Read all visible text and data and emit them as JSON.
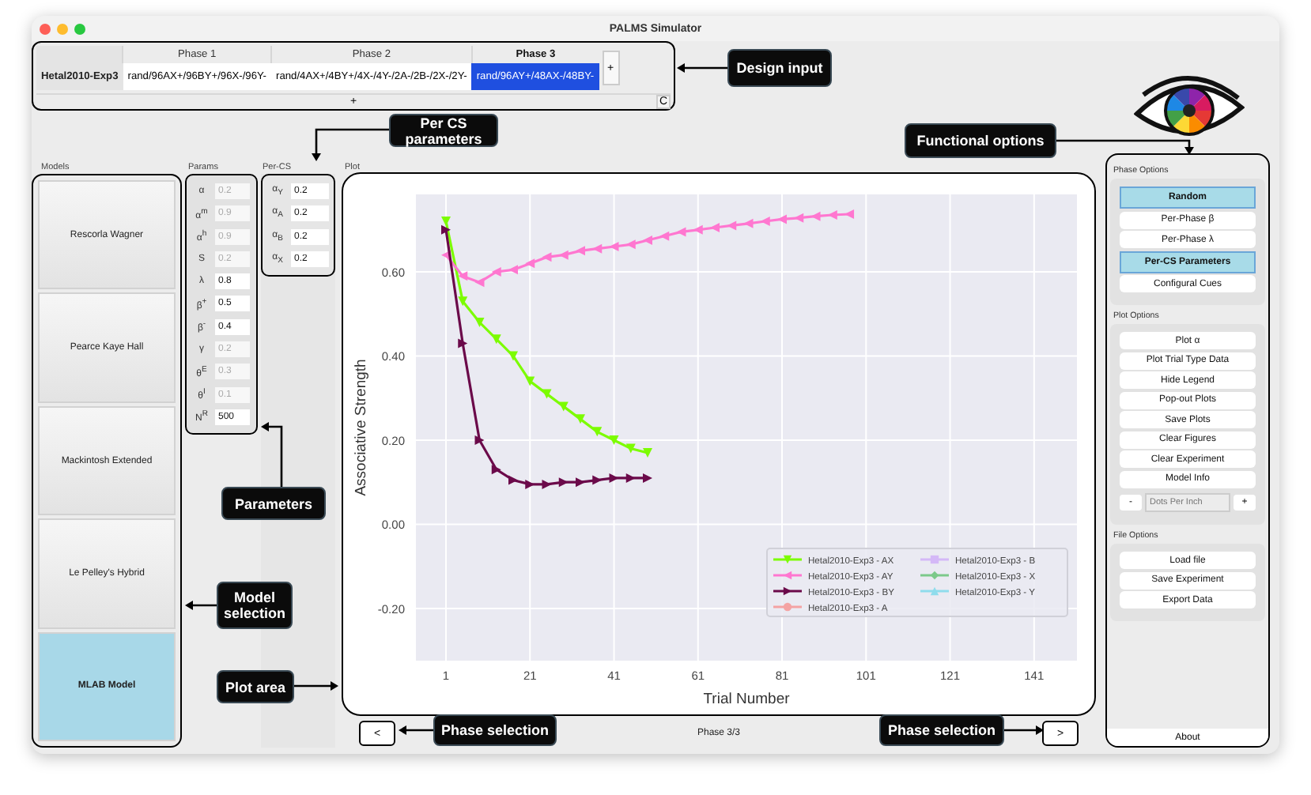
{
  "window": {
    "title": "PALMS Simulator"
  },
  "design": {
    "phases": [
      {
        "label": "Phase 1",
        "current": false
      },
      {
        "label": "Phase 2",
        "current": false
      },
      {
        "label": "Phase 3",
        "current": true
      }
    ],
    "rows": [
      {
        "name": "Hetal2010-Exp3",
        "cells": [
          {
            "text": "rand/96AX+/96BY+/96X-/96Y-",
            "selected": false
          },
          {
            "text": "rand/4AX+/4BY+/4X-/4Y-/2A-/2B-/2X-/2Y-",
            "selected": false
          },
          {
            "text": "rand/96AY+/48AX-/48BY-",
            "selected": true
          }
        ]
      }
    ],
    "add_phase_button": "+",
    "add_row_button": "+",
    "corner_button": "C"
  },
  "models": {
    "title": "Models",
    "items": [
      {
        "label": "Rescorla Wagner",
        "selected": false
      },
      {
        "label": "Pearce Kaye Hall",
        "selected": false
      },
      {
        "label": "Mackintosh Extended",
        "selected": false
      },
      {
        "label": "Le Pelley's Hybrid",
        "selected": false
      },
      {
        "label": "MLAB Model",
        "selected": true
      }
    ]
  },
  "params": {
    "title": "Params",
    "items": [
      {
        "label": "α",
        "value": "0.2",
        "disabled": true
      },
      {
        "label": "α$^{m}$",
        "value": "0.9",
        "disabled": true
      },
      {
        "label": "α$^{h}$",
        "value": "0.9",
        "disabled": true
      },
      {
        "label": "S",
        "value": "0.2",
        "disabled": true
      },
      {
        "label": "λ",
        "value": "0.8",
        "disabled": false
      },
      {
        "label": "β$^{+}$",
        "value": "0.5",
        "disabled": false
      },
      {
        "label": "β$^{-}$",
        "value": "0.4",
        "disabled": false
      },
      {
        "label": "γ",
        "value": "0.2",
        "disabled": true
      },
      {
        "label": "θ$^{E}$",
        "value": "0.3",
        "disabled": true
      },
      {
        "label": "θ$^{I}$",
        "value": "0.1",
        "disabled": true
      },
      {
        "label": "N$^{R}$",
        "value": "500",
        "disabled": false
      }
    ]
  },
  "per_cs": {
    "title": "Per-CS",
    "items": [
      {
        "label": "α$_{Y}$",
        "value": "0.2"
      },
      {
        "label": "α$_{A}$",
        "value": "0.2"
      },
      {
        "label": "α$_{B}$",
        "value": "0.2"
      },
      {
        "label": "α$_{X}$",
        "value": "0.2"
      }
    ]
  },
  "plot": {
    "title": "Plot",
    "chart_data": {
      "type": "line",
      "xlabel": "Trial Number",
      "ylabel": "Associative Strength",
      "x": [
        1,
        5,
        9,
        13,
        17,
        21,
        25,
        29,
        33,
        37,
        41,
        45,
        49,
        53,
        57,
        61,
        65,
        69,
        73,
        77,
        81,
        85,
        89,
        93,
        97
      ],
      "series": [
        {
          "name": "Hetal2010-Exp3 - AX",
          "color": "#7cfc00",
          "marker": "triangle",
          "values": [
            0.72,
            0.53,
            0.48,
            0.44,
            0.4,
            0.34,
            0.31,
            0.28,
            0.25,
            0.22,
            0.2,
            0.18,
            0.17,
            null,
            null,
            null,
            null,
            null,
            null,
            null,
            null,
            null,
            null,
            null,
            null
          ]
        },
        {
          "name": "Hetal2010-Exp3 - AY",
          "color": "#ff77d0",
          "marker": "triangle",
          "values": [
            0.64,
            0.59,
            0.575,
            0.6,
            0.605,
            0.62,
            0.635,
            0.64,
            0.65,
            0.655,
            0.66,
            0.665,
            0.675,
            0.685,
            0.695,
            0.7,
            0.705,
            0.71,
            0.715,
            0.72,
            0.725,
            0.728,
            0.732,
            0.735,
            0.737
          ]
        },
        {
          "name": "Hetal2010-Exp3 - BY",
          "color": "#6b0a4a",
          "marker": "triangle",
          "values": [
            0.7,
            0.43,
            0.2,
            0.13,
            0.105,
            0.095,
            0.095,
            0.1,
            0.1,
            0.105,
            0.11,
            0.11,
            0.11,
            null,
            null,
            null,
            null,
            null,
            null,
            null,
            null,
            null,
            null,
            null,
            null
          ]
        },
        {
          "name": "Hetal2010-Exp3 - A",
          "color": "#f4a3a3",
          "marker": "circle",
          "values": [
            null,
            null,
            null,
            null,
            null,
            null,
            null,
            null,
            null,
            null,
            null,
            null,
            null,
            null,
            null,
            null,
            null,
            null,
            null,
            null,
            null,
            null,
            null,
            null,
            null
          ]
        },
        {
          "name": "Hetal2010-Exp3 - B",
          "color": "#d4b8f7",
          "marker": "square",
          "values": [
            null,
            null,
            null,
            null,
            null,
            null,
            null,
            null,
            null,
            null,
            null,
            null,
            null,
            null,
            null,
            null,
            null,
            null,
            null,
            null,
            null,
            null,
            null,
            null,
            null
          ]
        },
        {
          "name": "Hetal2010-Exp3 - X",
          "color": "#7cc98a",
          "marker": "diamond",
          "values": [
            null,
            null,
            null,
            null,
            null,
            null,
            null,
            null,
            null,
            null,
            null,
            null,
            null,
            null,
            null,
            null,
            null,
            null,
            null,
            null,
            null,
            null,
            null,
            null,
            null
          ]
        },
        {
          "name": "Hetal2010-Exp3 - Y",
          "color": "#8fdcec",
          "marker": "triangle",
          "values": [
            null,
            null,
            null,
            null,
            null,
            null,
            null,
            null,
            null,
            null,
            null,
            null,
            null,
            null,
            null,
            null,
            null,
            null,
            null,
            null,
            null,
            null,
            null,
            null,
            null
          ]
        }
      ],
      "grid": true,
      "legend": true,
      "xlim": [
        -6.15,
        151.2
      ],
      "ylim": [
        -0.324,
        0.784
      ],
      "xticks": [
        1,
        21,
        41,
        61,
        81,
        101,
        121,
        141
      ],
      "yticks": [
        {
          "value": -0.2,
          "label": "-0.20"
        },
        {
          "value": 0,
          "label": "0.00"
        },
        {
          "value": 0.2,
          "label": "0.20"
        },
        {
          "value": 0.4,
          "label": "0.40"
        },
        {
          "value": 0.6,
          "label": "0.60"
        }
      ]
    },
    "prev_button": "<",
    "phase_label": "Phase 3/3",
    "next_button": ">"
  },
  "options": {
    "groups": [
      {
        "title": "Phase Options",
        "buttons": [
          {
            "label": "Random",
            "selected": true
          },
          {
            "label": "Per-Phase β",
            "selected": false
          },
          {
            "label": "Per-Phase λ",
            "selected": false
          },
          {
            "label": "Per-CS Parameters",
            "selected": true
          },
          {
            "label": "Configural Cues",
            "selected": false
          }
        ]
      },
      {
        "title": "Plot Options",
        "buttons": [
          {
            "label": "Plot α",
            "selected": false
          },
          {
            "label": "Plot Trial Type Data",
            "selected": false
          },
          {
            "label": "Hide Legend",
            "selected": false
          },
          {
            "label": "Pop-out Plots",
            "selected": false
          },
          {
            "label": "Save Plots",
            "selected": false
          },
          {
            "label": "Clear Figures",
            "selected": false
          },
          {
            "label": "Clear Experiment",
            "selected": false
          },
          {
            "label": "Model Info",
            "selected": false
          }
        ],
        "dpi": {
          "minus": "-",
          "placeholder": "Dots Per Inch",
          "plus": "+"
        }
      },
      {
        "title": "File Options",
        "buttons": [
          {
            "label": "Load file",
            "selected": false
          },
          {
            "label": "Save Experiment",
            "selected": false
          },
          {
            "label": "Export Data",
            "selected": false
          }
        ]
      }
    ],
    "about": "About"
  },
  "annotations": [
    {
      "text": "Design input"
    },
    {
      "text": "Per CS parameters"
    },
    {
      "text": "Functional options"
    },
    {
      "text": "Parameters"
    },
    {
      "text": "Model selection"
    },
    {
      "text": "Plot area"
    },
    {
      "text": "Phase selection"
    },
    {
      "text": "Phase selection"
    }
  ]
}
